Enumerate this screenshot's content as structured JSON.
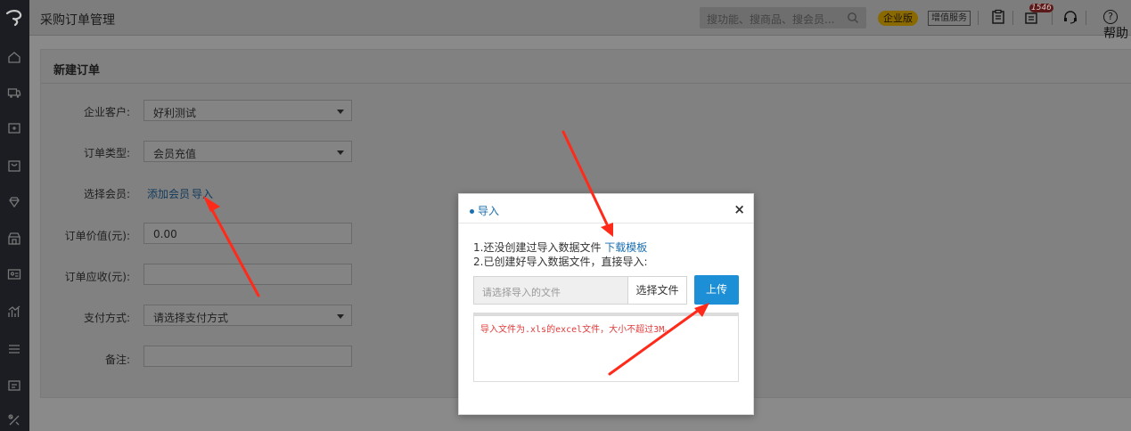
{
  "header": {
    "title": "采购订单管理",
    "search_placeholder": "搜功能、搜商品、搜会员...",
    "badge_enterprise": "企业版",
    "badge_value_service": "增值服务",
    "notice_count": "1546",
    "help_label": "帮助"
  },
  "form": {
    "title": "新建订单",
    "customer_label": "企业客户:",
    "customer_value": "好利测试",
    "order_type_label": "订单类型:",
    "order_type_value": "会员充值",
    "member_label": "选择会员:",
    "add_member": "添加会员",
    "import_link": "导入",
    "order_value_label": "订单价值(元):",
    "order_value": "0.00",
    "receivable_label": "订单应收(元):",
    "payment_label": "支付方式:",
    "payment_placeholder": "请选择支付方式",
    "remark_label": "备注:"
  },
  "modal": {
    "title": "导入",
    "close": "×",
    "step1_text": "1.还没创建过导入数据文件",
    "download_template": "下载模板",
    "step2_text": "2.已创建好导入数据文件，直接导入:",
    "file_placeholder": "请选择导入的文件",
    "choose_file": "选择文件",
    "upload": "上传",
    "note": "导入文件为.xls的excel文件，大小不超过3M。"
  },
  "colors": {
    "accent": "#1d8fd6",
    "link": "#1a6fb0",
    "arrow": "#ff2a1a",
    "warning_text": "#e23b3b"
  }
}
